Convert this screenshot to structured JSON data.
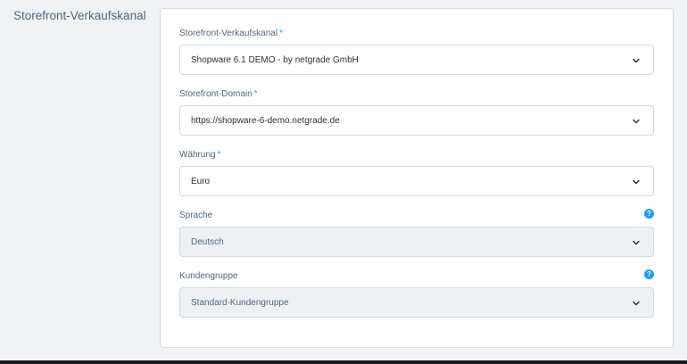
{
  "section": {
    "title": "Storefront-Verkaufskanal"
  },
  "fields": [
    {
      "label": "Storefront-Verkaufskanal",
      "required_mark": "*",
      "value": "Shopware 6.1 DEMO - by netgrade GmbH"
    },
    {
      "label": "Storefront-Domain",
      "required_mark": "*",
      "value": "https://shopware-6-demo.netgrade.de"
    },
    {
      "label": "Währung",
      "required_mark": "*",
      "value": "Euro"
    },
    {
      "label": "Sprache",
      "help_icon": "?",
      "value": "Deutsch"
    },
    {
      "label": "Kundengruppe",
      "help_icon": "?",
      "value": "Standard-Kundengruppe"
    }
  ],
  "colors": {
    "accent": "#189eff",
    "text": "#52667a",
    "disabled_bg": "#eef1f4"
  },
  "icons": {
    "dropdown": "chevron-down-icon",
    "help": "help-icon"
  }
}
